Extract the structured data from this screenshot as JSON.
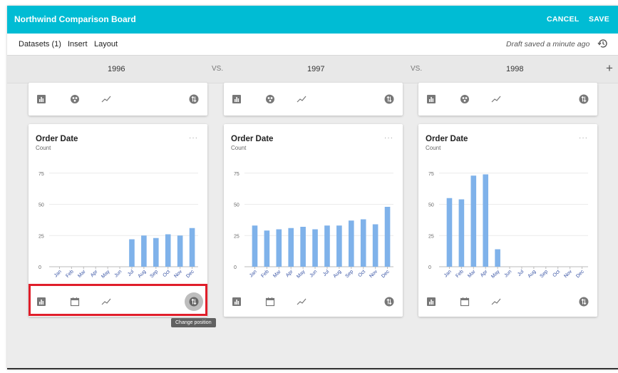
{
  "header": {
    "title": "Northwind Comparison Board",
    "cancel_label": "CANCEL",
    "save_label": "SAVE"
  },
  "menu": {
    "datasets": "Datasets (1)",
    "insert": "Insert",
    "layout": "Layout",
    "draft_status": "Draft saved a minute ago"
  },
  "comparison": {
    "vs_label": "VS."
  },
  "columns": [
    {
      "year": "1996",
      "card_title": "Order Date",
      "card_subtitle": "Count"
    },
    {
      "year": "1997",
      "card_title": "Order Date",
      "card_subtitle": "Count"
    },
    {
      "year": "1998",
      "card_title": "Order Date",
      "card_subtitle": "Count"
    }
  ],
  "tooltip": {
    "text": "Change position"
  },
  "colors": {
    "accent": "#00bcd4",
    "bar": "#7fb2ea",
    "highlight": "#e01e2a"
  },
  "icons": {
    "top_row": [
      "bar-chart-icon",
      "bubble-chart-icon",
      "line-chart-icon",
      "change-position-icon"
    ],
    "bottom_row": [
      "bar-chart-icon",
      "calendar-icon",
      "line-chart-icon",
      "change-position-icon"
    ]
  },
  "chart_data": [
    {
      "type": "bar",
      "title": "Order Date",
      "ylabel": "Count",
      "categories": [
        "Jan",
        "Feb",
        "Mar",
        "Apr",
        "May",
        "Jun",
        "Jul",
        "Aug",
        "Sep",
        "Oct",
        "Nov",
        "Dec"
      ],
      "values": [
        0,
        0,
        0,
        0,
        0,
        0,
        22,
        25,
        23,
        26,
        25,
        31
      ],
      "yticks": [
        0,
        25,
        50,
        75
      ],
      "ylim": [
        0,
        80
      ]
    },
    {
      "type": "bar",
      "title": "Order Date",
      "ylabel": "Count",
      "categories": [
        "Jan",
        "Feb",
        "Mar",
        "Apr",
        "May",
        "Jun",
        "Jul",
        "Aug",
        "Sep",
        "Oct",
        "Nov",
        "Dec"
      ],
      "values": [
        33,
        29,
        30,
        31,
        32,
        30,
        33,
        33,
        37,
        38,
        34,
        48
      ],
      "yticks": [
        0,
        25,
        50,
        75
      ],
      "ylim": [
        0,
        80
      ]
    },
    {
      "type": "bar",
      "title": "Order Date",
      "ylabel": "Count",
      "categories": [
        "Jan",
        "Feb",
        "Mar",
        "Apr",
        "May",
        "Jun",
        "Jul",
        "Aug",
        "Sep",
        "Oct",
        "Nov",
        "Dec"
      ],
      "values": [
        55,
        54,
        73,
        74,
        14,
        0,
        0,
        0,
        0,
        0,
        0,
        0
      ],
      "yticks": [
        0,
        25,
        50,
        75
      ],
      "ylim": [
        0,
        80
      ]
    }
  ]
}
